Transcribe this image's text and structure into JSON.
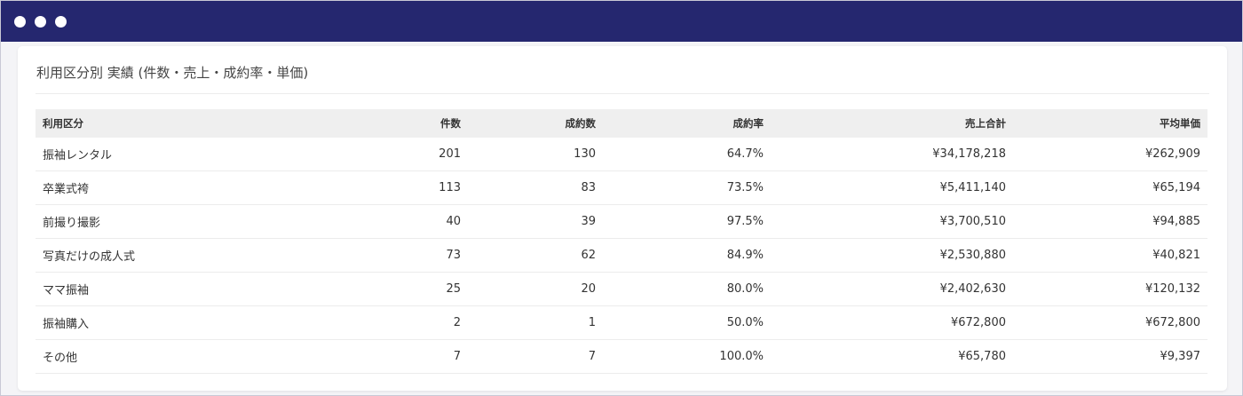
{
  "window": {
    "controls": [
      "dot",
      "dot",
      "dot"
    ]
  },
  "card": {
    "title": "利用区分別 実績 (件数・売上・成約率・単価)"
  },
  "table": {
    "columns": [
      "利用区分",
      "件数",
      "成約数",
      "成約率",
      "売上合計",
      "平均単価"
    ],
    "rows": [
      [
        "振袖レンタル",
        "201",
        "130",
        "64.7%",
        "¥34,178,218",
        "¥262,909"
      ],
      [
        "卒業式袴",
        "113",
        "83",
        "73.5%",
        "¥5,411,140",
        "¥65,194"
      ],
      [
        "前撮り撮影",
        "40",
        "39",
        "97.5%",
        "¥3,700,510",
        "¥94,885"
      ],
      [
        "写真だけの成人式",
        "73",
        "62",
        "84.9%",
        "¥2,530,880",
        "¥40,821"
      ],
      [
        "ママ振袖",
        "25",
        "20",
        "80.0%",
        "¥2,402,630",
        "¥120,132"
      ],
      [
        "振袖購入",
        "2",
        "1",
        "50.0%",
        "¥672,800",
        "¥672,800"
      ],
      [
        "その他",
        "7",
        "7",
        "100.0%",
        "¥65,780",
        "¥9,397"
      ]
    ]
  },
  "colors": {
    "titlebar": "#25276f",
    "header_row": "#efefef",
    "text": "#333333"
  }
}
